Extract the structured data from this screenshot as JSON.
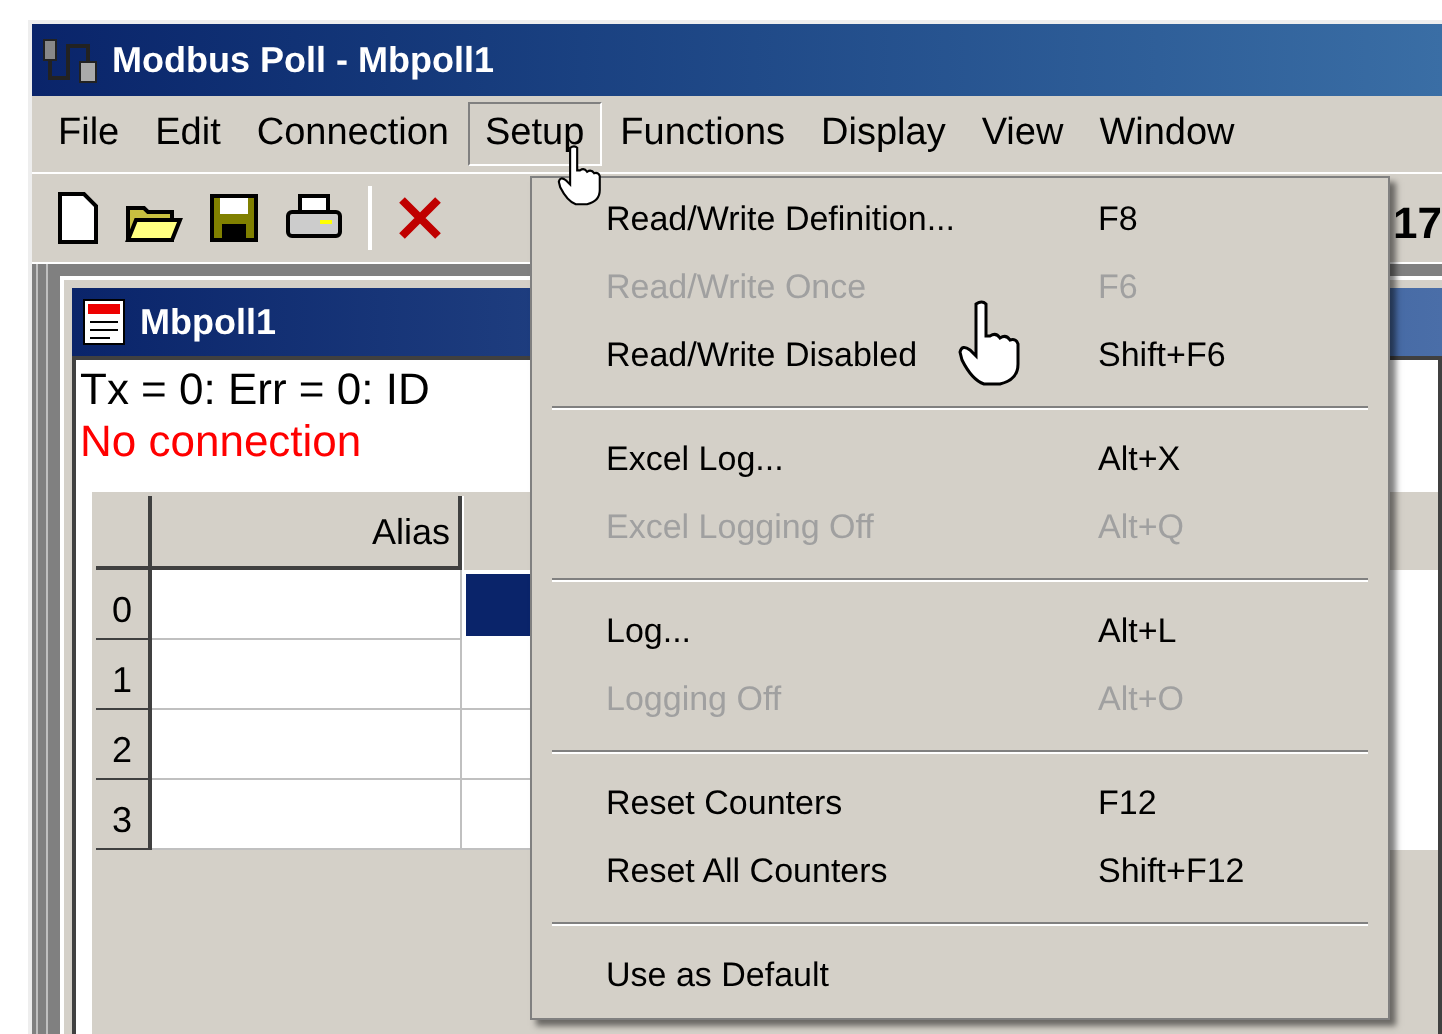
{
  "window": {
    "title": "Modbus Poll - Mbpoll1"
  },
  "menu_bar": [
    {
      "label": "File",
      "selected": false
    },
    {
      "label": "Edit",
      "selected": false
    },
    {
      "label": "Connection",
      "selected": false
    },
    {
      "label": "Setup",
      "selected": true
    },
    {
      "label": "Functions",
      "selected": false
    },
    {
      "label": "Display",
      "selected": false
    },
    {
      "label": "View",
      "selected": false
    },
    {
      "label": "Window",
      "selected": false
    }
  ],
  "toolbar": {
    "cut_text": "17"
  },
  "child_window": {
    "title": "Mbpoll1",
    "status": "Tx = 0: Err = 0: ID",
    "error": "No connection"
  },
  "grid": {
    "columns": [
      "Alias"
    ],
    "rows": [
      {
        "header": "0",
        "selected": true
      },
      {
        "header": "1",
        "selected": false
      },
      {
        "header": "2",
        "selected": false
      },
      {
        "header": "3",
        "selected": false
      }
    ]
  },
  "dropdown": {
    "items": [
      {
        "kind": "item",
        "label": "Read/Write Definition...",
        "shortcut": "F8",
        "disabled": false
      },
      {
        "kind": "item",
        "label": "Read/Write Once",
        "shortcut": "F6",
        "disabled": true
      },
      {
        "kind": "item",
        "label": "Read/Write Disabled",
        "shortcut": "Shift+F6",
        "disabled": false
      },
      {
        "kind": "separator"
      },
      {
        "kind": "item",
        "label": "Excel Log...",
        "shortcut": "Alt+X",
        "disabled": false
      },
      {
        "kind": "item",
        "label": "Excel Logging Off",
        "shortcut": "Alt+Q",
        "disabled": true
      },
      {
        "kind": "separator"
      },
      {
        "kind": "item",
        "label": "Log...",
        "shortcut": "Alt+L",
        "disabled": false
      },
      {
        "kind": "item",
        "label": "Logging Off",
        "shortcut": "Alt+O",
        "disabled": true
      },
      {
        "kind": "separator"
      },
      {
        "kind": "item",
        "label": "Reset Counters",
        "shortcut": "F12",
        "disabled": false
      },
      {
        "kind": "item",
        "label": "Reset All Counters",
        "shortcut": "Shift+F12",
        "disabled": false
      },
      {
        "kind": "separator"
      },
      {
        "kind": "item",
        "label": "Use as Default",
        "disabled": false
      }
    ]
  }
}
